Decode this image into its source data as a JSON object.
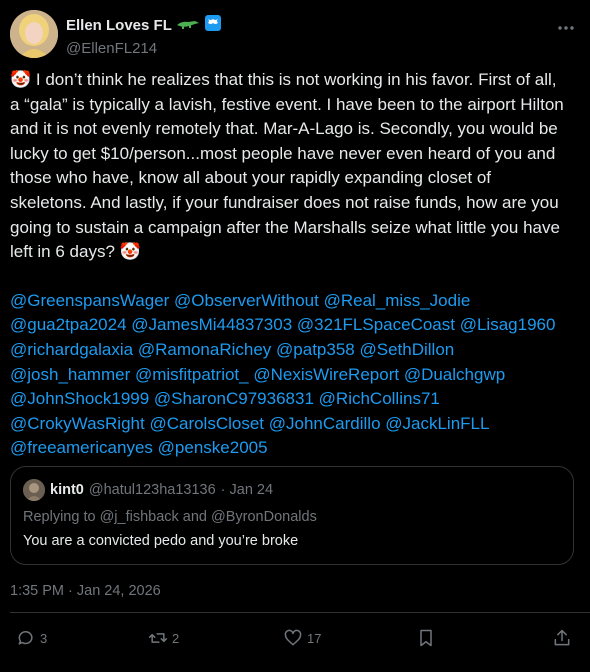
{
  "author": {
    "display_name": "Ellen Loves FL",
    "handle": "@EllenFL214",
    "verified": true
  },
  "tweet": {
    "text": "🤡 I don’t think he realizes that this is not working in his favor.  First of all, a “gala” is typically a lavish, festive event.  I have been to the airport Hilton and it is not evenly remotely that.  Mar-A-Lago is.  Secondly, you would be lucky to get $10/person...most people have never even heard of you and those who have, know all about your rapidly expanding closet of skeletons.  And lastly, if your fundraiser does not raise funds, how are you going to sustain a campaign after the Marshalls seize what little you have left in 6 days? 🤡",
    "mentions": [
      "@GreenspansWager",
      "@ObserverWithout",
      "@Real_miss_Jodie",
      "@gua2tpa2024",
      "@JamesMi44837303",
      "@321FLSpaceCoast",
      "@Lisag1960",
      "@richardgalaxia",
      "@RamonaRichey",
      "@patp358",
      "@SethDillon",
      "@josh_hammer",
      "@misfitpatriot_",
      "@NexisWireReport",
      "@Dualchgwp",
      "@JohnShock1999",
      "@SharonC97936831",
      "@RichCollins71",
      "@CrokyWasRight",
      "@CarolsCloset",
      "@JohnCardillo",
      "@JackLinFLL",
      "@freeamericanyes",
      "@penske2005"
    ],
    "timestamp": "1:35 PM · Jan 24, 2026"
  },
  "quote": {
    "name": "kint0",
    "handle": "@hatul123ha13136",
    "date": "· Jan 24",
    "replying_to": "Replying to @j_fishback and @ByronDonalds",
    "text": "You are a convicted pedo and you’re broke"
  },
  "actions": {
    "replies": "3",
    "reposts": "2",
    "likes": "17"
  },
  "colors": {
    "background": "#000000",
    "accent": "#1d9bf0",
    "muted": "#71767b",
    "border": "#2f3336"
  }
}
